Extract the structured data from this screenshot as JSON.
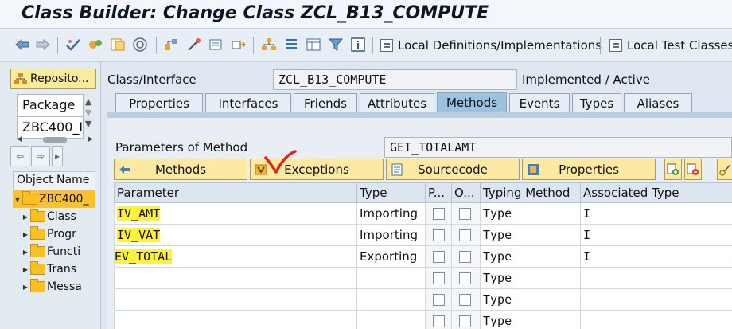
{
  "window": {
    "title": "Class Builder: Change Class ZCL_B13_COMPUTE"
  },
  "toolbar": {
    "local_definitions_label": "Local Definitions/Implementations",
    "local_test_classes_label": "Local Test Classes"
  },
  "navigator": {
    "repository_button": "Reposito...",
    "object_type": "Package",
    "object_value": "ZBC400_I",
    "column_header": "Object Name",
    "tree": [
      {
        "label": "ZBC400_",
        "selected": true
      },
      {
        "label": "Class"
      },
      {
        "label": "Progr"
      },
      {
        "label": "Functi"
      },
      {
        "label": "Trans"
      },
      {
        "label": "Messa"
      }
    ]
  },
  "header": {
    "class_label": "Class/Interface",
    "class_value": "ZCL_B13_COMPUTE",
    "status": "Implemented / Active"
  },
  "tabs": [
    {
      "label": "Properties"
    },
    {
      "label": "Interfaces"
    },
    {
      "label": "Friends"
    },
    {
      "label": "Attributes"
    },
    {
      "label": "Methods",
      "active": true
    },
    {
      "label": "Events"
    },
    {
      "label": "Types"
    },
    {
      "label": "Aliases"
    }
  ],
  "method": {
    "label": "Parameters of Method",
    "value": "GET_TOTALAMT"
  },
  "buttons": {
    "methods": "Methods",
    "exceptions": "Exceptions",
    "sourcecode": "Sourcecode",
    "properties": "Properties"
  },
  "grid": {
    "columns": [
      "Parameter",
      "Type",
      "P...",
      "O...",
      "Typing Method",
      "Associated Type"
    ],
    "rows": [
      {
        "parameter": "IV_AMT",
        "type": "Importing",
        "typing": "Type",
        "assoc": "I"
      },
      {
        "parameter": "IV_VAT",
        "type": "Importing",
        "typing": "Type",
        "assoc": "I"
      },
      {
        "parameter": "EV_TOTAL",
        "type": "Exporting",
        "typing": "Type",
        "assoc": "I"
      },
      {
        "parameter": "",
        "type": "",
        "typing": "Type",
        "assoc": ""
      },
      {
        "parameter": "",
        "type": "",
        "typing": "Type",
        "assoc": ""
      },
      {
        "parameter": "",
        "type": "",
        "typing": "Type",
        "assoc": ""
      }
    ]
  },
  "colors": {
    "highlight": "#fff23a",
    "active_tab": "#9cc2e2",
    "button": "#fbe9a4",
    "annotation_red": "#e0261b"
  }
}
